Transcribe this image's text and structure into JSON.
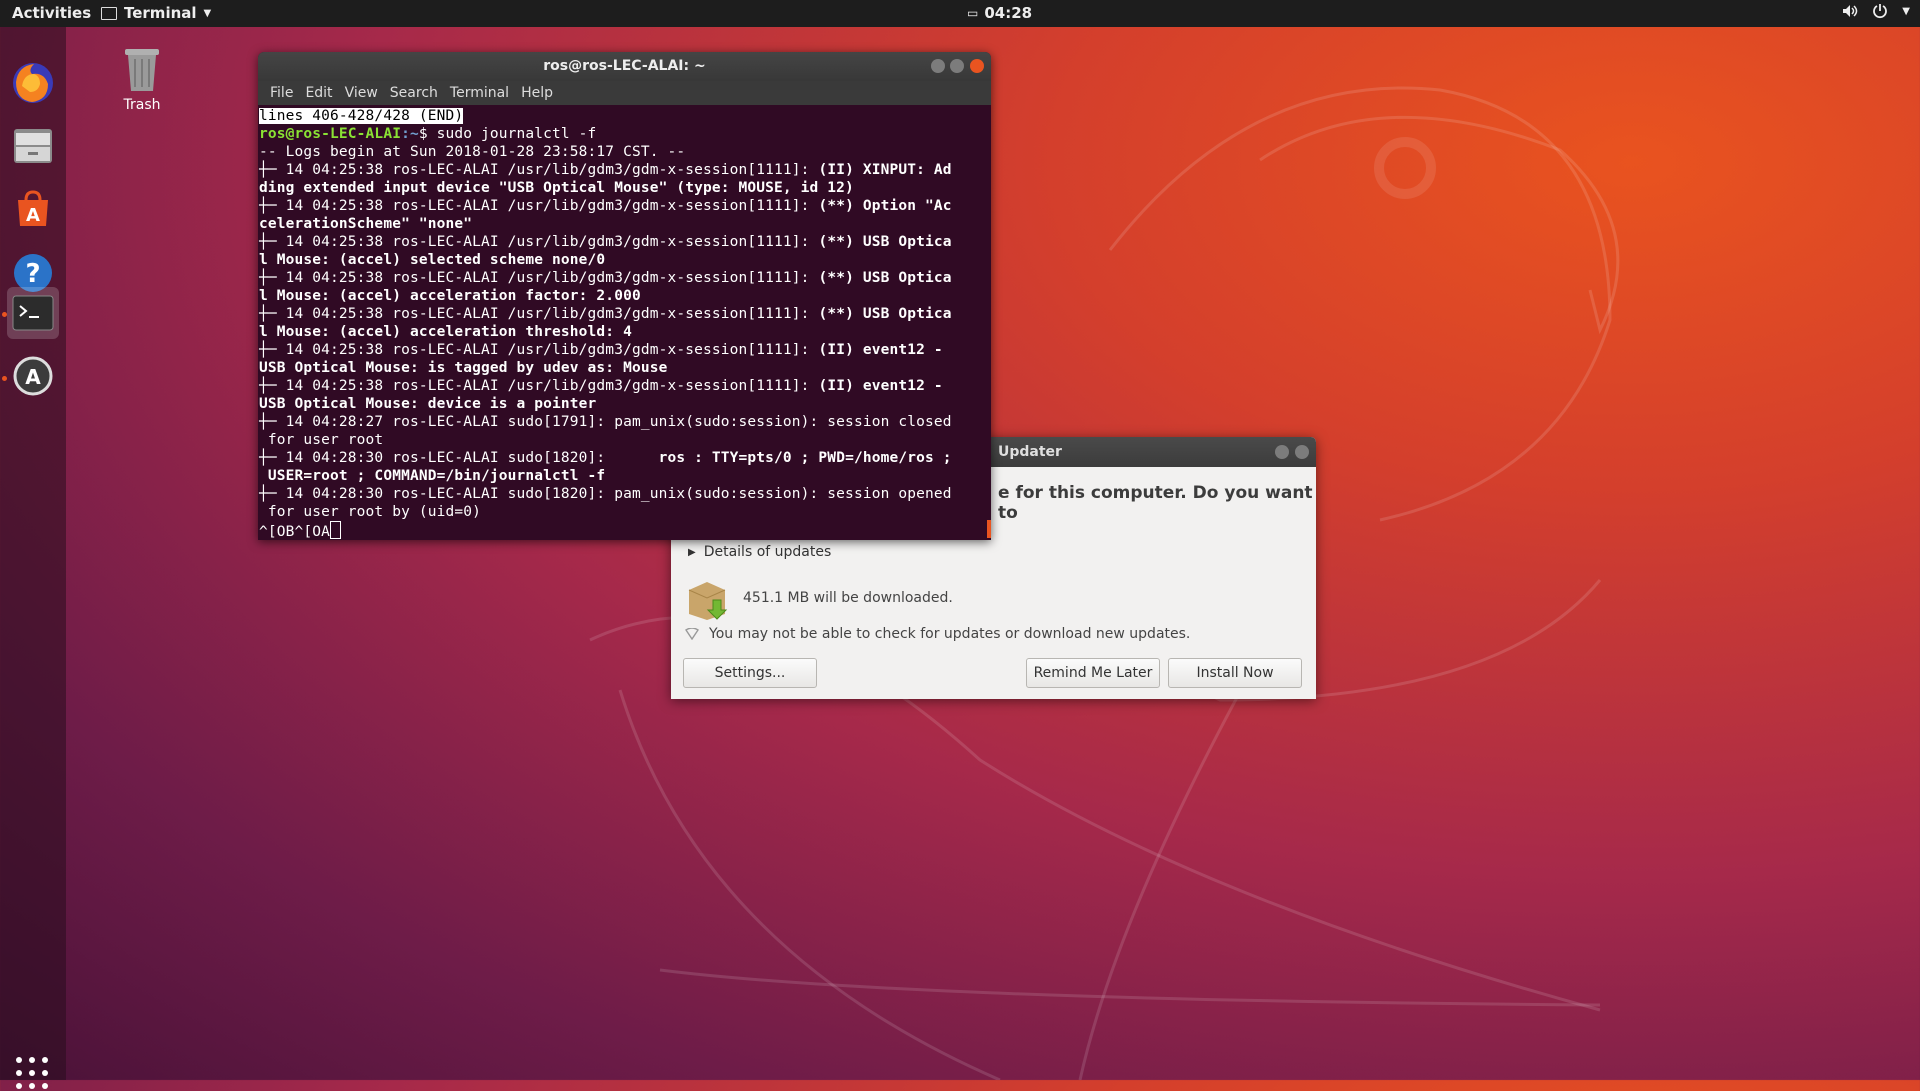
{
  "topbar": {
    "activities": "Activities",
    "app_menu": "Terminal",
    "clock": "04:28"
  },
  "dock": {
    "items": [
      "firefox-icon",
      "files-icon",
      "software-icon",
      "help-icon",
      "terminal-icon",
      "updater-icon"
    ],
    "show_apps": "apps-grid-icon"
  },
  "desktop": {
    "trash_label": "Trash"
  },
  "terminal": {
    "title": "ros@ros-LEC-ALAI: ~",
    "menu": [
      "File",
      "Edit",
      "View",
      "Search",
      "Terminal",
      "Help"
    ],
    "status_line": "lines 406-428/428 (END)",
    "prompt_user": "ros@ros-LEC-ALAI",
    "prompt_path": ":~",
    "prompt_cmd": "$ sudo journalctl -f",
    "lines": [
      {
        "n": "-- Logs begin at Sun 2018-01-28 23:58:17 CST. --",
        "b": ""
      },
      {
        "n": "┼─ 14 04:25:38 ros-LEC-ALAI /usr/lib/gdm3/gdm-x-session[1111]: ",
        "b": "(II) XINPUT: Ad"
      },
      {
        "n": "",
        "b": "ding extended input device \"USB Optical Mouse\" (type: MOUSE, id 12)"
      },
      {
        "n": "┼─ 14 04:25:38 ros-LEC-ALAI /usr/lib/gdm3/gdm-x-session[1111]: ",
        "b": "(**) Option \"Ac"
      },
      {
        "n": "",
        "b": "celerationScheme\" \"none\""
      },
      {
        "n": "┼─ 14 04:25:38 ros-LEC-ALAI /usr/lib/gdm3/gdm-x-session[1111]: ",
        "b": "(**) USB Optica"
      },
      {
        "n": "",
        "b": "l Mouse: (accel) selected scheme none/0"
      },
      {
        "n": "┼─ 14 04:25:38 ros-LEC-ALAI /usr/lib/gdm3/gdm-x-session[1111]: ",
        "b": "(**) USB Optica"
      },
      {
        "n": "",
        "b": "l Mouse: (accel) acceleration factor: 2.000"
      },
      {
        "n": "┼─ 14 04:25:38 ros-LEC-ALAI /usr/lib/gdm3/gdm-x-session[1111]: ",
        "b": "(**) USB Optica"
      },
      {
        "n": "",
        "b": "l Mouse: (accel) acceleration threshold: 4"
      },
      {
        "n": "┼─ 14 04:25:38 ros-LEC-ALAI /usr/lib/gdm3/gdm-x-session[1111]: ",
        "b": "(II) event12 -"
      },
      {
        "n": "",
        "b": "USB Optical Mouse: is tagged by udev as: Mouse"
      },
      {
        "n": "┼─ 14 04:25:38 ros-LEC-ALAI /usr/lib/gdm3/gdm-x-session[1111]: ",
        "b": "(II) event12 -"
      },
      {
        "n": "",
        "b": "USB Optical Mouse: device is a pointer"
      },
      {
        "n": "┼─ 14 04:28:27 ros-LEC-ALAI sudo[1791]: pam_unix(sudo:session): session closed",
        "b": ""
      },
      {
        "n": " for user root",
        "b": ""
      },
      {
        "n": "┼─ 14 04:28:30 ros-LEC-ALAI sudo[1820]:      ",
        "b": "ros : TTY=pts/0 ; PWD=/home/ros ;"
      },
      {
        "n": "",
        "b": " USER=root ; COMMAND=/bin/journalctl -f"
      },
      {
        "n": "┼─ 14 04:28:30 ros-LEC-ALAI sudo[1820]: pam_unix(sudo:session): session opened",
        "b": ""
      },
      {
        "n": " for user root by (uid=0)",
        "b": ""
      }
    ],
    "input_line": "^[OB^[OA"
  },
  "updater": {
    "title_visible": "Updater",
    "message_visible": "e for this computer. Do you want to",
    "details": "Details of updates",
    "download_size": "451.1 MB will be downloaded.",
    "warning": "You may not be able to check for updates or download new updates.",
    "settings_btn": "Settings...",
    "remind_btn": "Remind Me Later",
    "install_btn": "Install Now"
  }
}
